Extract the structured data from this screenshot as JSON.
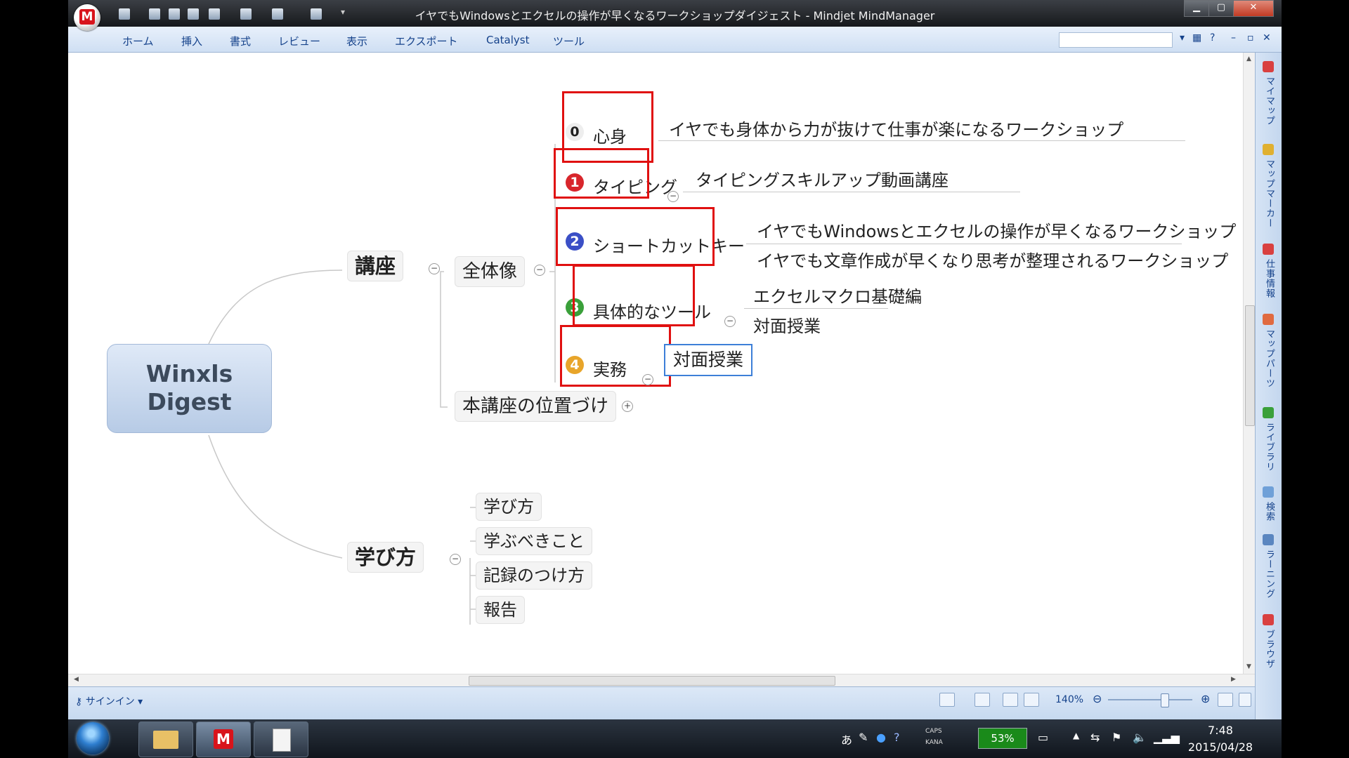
{
  "window": {
    "title": "イヤでもWindowsとエクセルの操作が早くなるワークショップダイジェスト - Mindjet MindManager",
    "logo_letter": "M",
    "min": "▁",
    "max": "▢",
    "close": "✕"
  },
  "menu": [
    "ホーム",
    "挿入",
    "書式",
    "レビュー",
    "表示",
    "エクスポート",
    "Catalyst",
    "ツール"
  ],
  "side_panel": [
    "マイマップ",
    "マップマーカー",
    "仕事情報",
    "マップパーツ",
    "ライブラリ",
    "検索",
    "ラーニング",
    "ブラウザ"
  ],
  "mindmap": {
    "central": [
      "Winxls",
      "Digest"
    ],
    "main_topics": {
      "kouza": "講座",
      "manabikata": "学び方"
    },
    "zentaizo": "全体像",
    "ichiduke": "本講座の位置づけ",
    "courses": [
      {
        "num": "0",
        "label": "心身",
        "details": [
          "イヤでも身体から力が抜けて仕事が楽になるワークショップ"
        ]
      },
      {
        "num": "1",
        "label": "タイピング",
        "details": [
          "タイピングスキルアップ動画講座"
        ]
      },
      {
        "num": "2",
        "label": "ショートカットキー",
        "details": [
          "イヤでもWindowsとエクセルの操作が早くなるワークショップ",
          "イヤでも文章作成が早くなり思考が整理されるワークショップ"
        ]
      },
      {
        "num": "3",
        "label": "具体的なツール",
        "details": [
          "エクセルマクロ基礎編",
          "対面授業"
        ]
      },
      {
        "num": "4",
        "label": "実務",
        "details": [
          "対面授業"
        ]
      }
    ],
    "manabikata_children": [
      "学び方",
      "学ぶべきこと",
      "記録のつけ方",
      "報告"
    ]
  },
  "statusbar": {
    "signin": "サインイン",
    "zoom": "140%"
  },
  "taskbar": {
    "ime": "あ",
    "caps": "CAPS",
    "kana": "KANA",
    "battery": "53%",
    "time": "7:48",
    "date": "2015/04/28"
  },
  "colors": {
    "red_highlight": "#e01010",
    "num0": "#2a2a2a",
    "num1": "#d8262c",
    "num2": "#3b4fc6",
    "num3": "#3aa03a",
    "num4": "#e8a52a"
  }
}
